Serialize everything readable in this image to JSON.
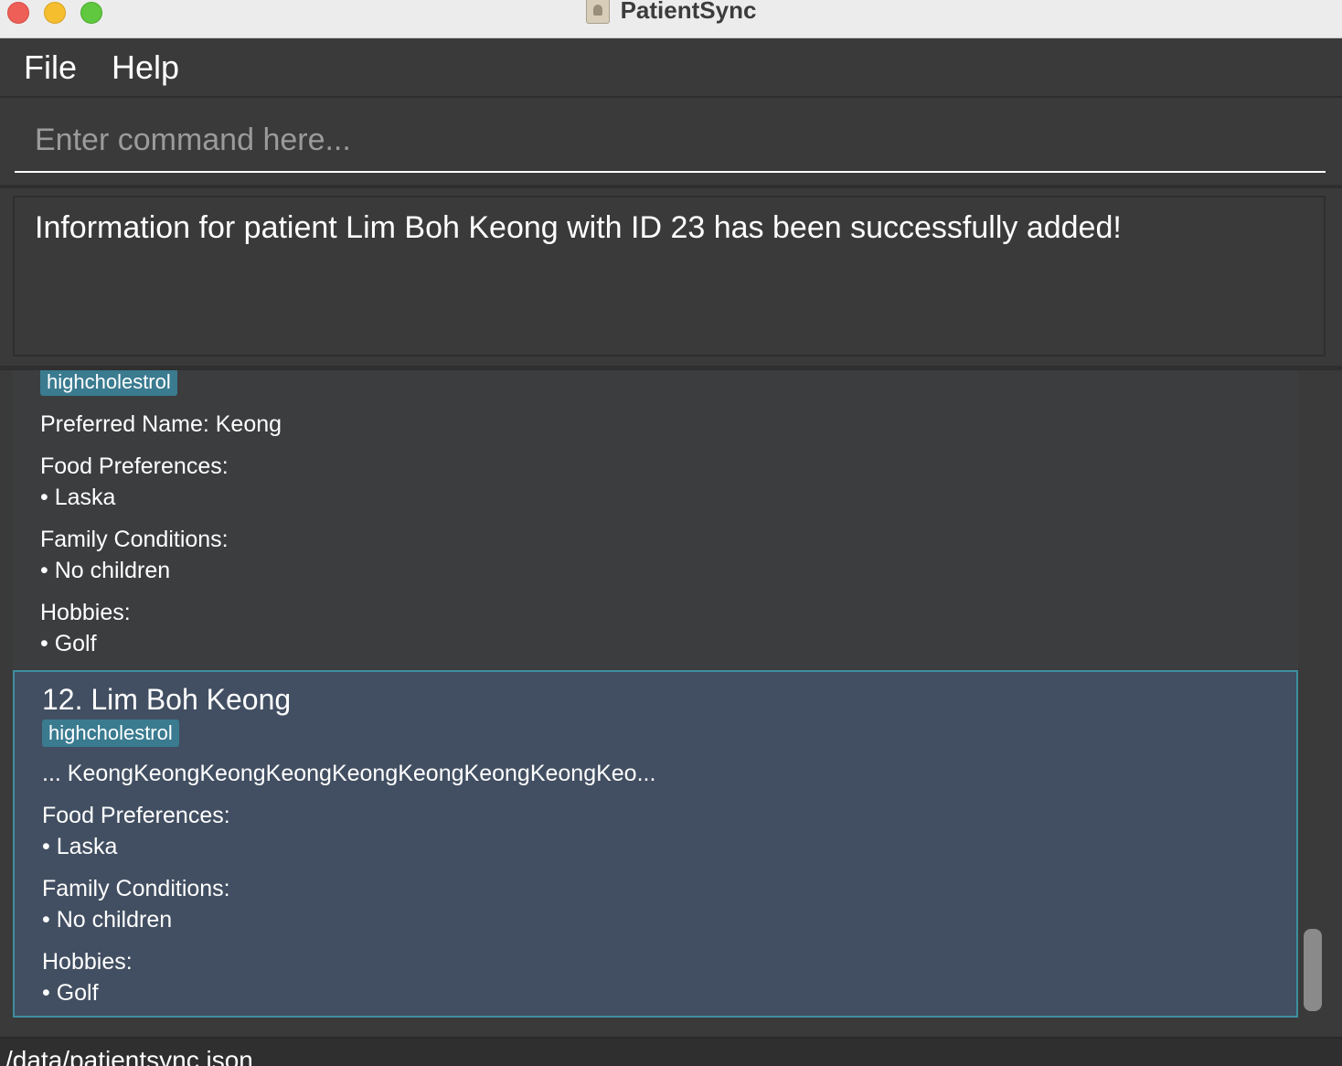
{
  "window": {
    "title": "PatientSync"
  },
  "menu": {
    "file": "File",
    "help": "Help"
  },
  "command": {
    "placeholder": "Enter command here..."
  },
  "result": {
    "message": "Information for patient Lim Boh Keong with ID 23 has been successfully added!"
  },
  "list": {
    "cards": [
      {
        "tag": "highcholestrol",
        "preferred_name": "Preferred Name:  Keong",
        "food_label": "Food Preferences:",
        "food_item": "• Laska",
        "family_label": "Family Conditions:",
        "family_item": "• No children",
        "hobbies_label": "Hobbies:",
        "hobbies_item": "• Golf"
      },
      {
        "title": "12.  Lim Boh Keong",
        "tag": "highcholestrol",
        "preferred_name": "...  KeongKeongKeongKeongKeongKeongKeongKeongKeo...",
        "food_label": "Food Preferences:",
        "food_item": "• Laska",
        "family_label": "Family Conditions:",
        "family_item": "• No children",
        "hobbies_label": "Hobbies:",
        "hobbies_item": "• Golf"
      }
    ]
  },
  "status": {
    "path": "/data/patientsync.json"
  }
}
